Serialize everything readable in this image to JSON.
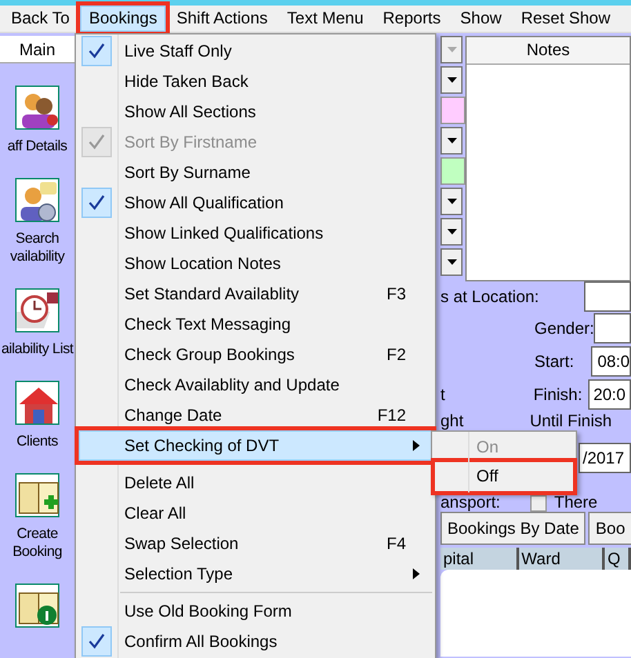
{
  "menubar": [
    {
      "label": "Back To",
      "open": false,
      "annotated": false
    },
    {
      "label": "Bookings",
      "open": true,
      "annotated": true
    },
    {
      "label": "Shift Actions",
      "open": false,
      "annotated": false
    },
    {
      "label": "Text Menu",
      "open": false,
      "annotated": false
    },
    {
      "label": "Reports",
      "open": false,
      "annotated": false
    },
    {
      "label": "Show",
      "open": false,
      "annotated": false
    },
    {
      "label": "Reset Show",
      "open": false,
      "annotated": false
    }
  ],
  "sidebar": {
    "tab": "Main",
    "items": [
      {
        "kind": "staff",
        "lines": [
          "aff Details"
        ]
      },
      {
        "kind": "search",
        "lines": [
          "Search",
          "vailability"
        ]
      },
      {
        "kind": "clock",
        "lines": [
          "ailability List"
        ]
      },
      {
        "kind": "house",
        "lines": [
          "Clients"
        ]
      },
      {
        "kind": "book-plus",
        "lines": [
          "Create",
          "Booking"
        ]
      },
      {
        "kind": "book-info"
      }
    ]
  },
  "combos": [
    {
      "kind": "arrow",
      "disabled": true
    },
    {
      "kind": "arrow",
      "disabled": false
    },
    {
      "kind": "swatch",
      "color": "#ffccff"
    },
    {
      "kind": "arrow",
      "disabled": false
    },
    {
      "kind": "swatch",
      "color": "#c0ffc0"
    },
    {
      "kind": "arrow",
      "disabled": false
    },
    {
      "kind": "arrow",
      "disabled": false
    },
    {
      "kind": "arrow",
      "disabled": false
    }
  ],
  "notes": {
    "header": "Notes"
  },
  "form": {
    "location_label": "s at Location:",
    "gender_label": "Gender:",
    "start_label": "Start:",
    "start_value": "08:0",
    "finish_label": "Finish:",
    "finish_value": "20:0",
    "left_text_1": "t",
    "left_text_2": "ght",
    "until_label": "Until Finish",
    "date_value": "/2017",
    "transport_label": "ansport:",
    "there_label": "There",
    "there_checked": false
  },
  "buttons": [
    "Bookings By Date",
    "Boo"
  ],
  "table": {
    "columns": [
      "pital",
      "Ward",
      "Q"
    ]
  },
  "dropdown": {
    "items": [
      {
        "kind": "item",
        "label": "Live Staff Only",
        "checked": true,
        "disabled": false
      },
      {
        "kind": "item",
        "label": "Hide Taken Back",
        "checked": false,
        "disabled": false
      },
      {
        "kind": "item",
        "label": "Show All Sections",
        "checked": false,
        "disabled": false
      },
      {
        "kind": "item",
        "label": "Sort By Firstname",
        "checked": true,
        "disabled": true
      },
      {
        "kind": "item",
        "label": "Sort By Surname",
        "checked": false,
        "disabled": false
      },
      {
        "kind": "item",
        "label": "Show All Qualification",
        "checked": true,
        "disabled": false
      },
      {
        "kind": "item",
        "label": "Show Linked Qualifications",
        "checked": false,
        "disabled": false
      },
      {
        "kind": "item",
        "label": "Show Location Notes",
        "checked": false,
        "disabled": false
      },
      {
        "kind": "item",
        "label": "Set Standard Availablity",
        "shortcut": "F3",
        "checked": false,
        "disabled": false
      },
      {
        "kind": "item",
        "label": "Check Text Messaging",
        "checked": false,
        "disabled": false
      },
      {
        "kind": "item",
        "label": "Check Group Bookings",
        "shortcut": "F2",
        "checked": false,
        "disabled": false
      },
      {
        "kind": "item",
        "label": "Check Availablity and Update",
        "checked": false,
        "disabled": false
      },
      {
        "kind": "item",
        "label": "Change Date",
        "shortcut": "F12",
        "checked": false,
        "disabled": false
      },
      {
        "kind": "submenu",
        "label": "Set Checking of DVT",
        "checked": false,
        "disabled": false,
        "highlighted": true,
        "annotated": true
      },
      {
        "kind": "separator"
      },
      {
        "kind": "item",
        "label": "Delete All",
        "checked": false,
        "disabled": false
      },
      {
        "kind": "item",
        "label": "Clear All",
        "checked": false,
        "disabled": false
      },
      {
        "kind": "item",
        "label": "Swap Selection",
        "shortcut": "F4",
        "checked": false,
        "disabled": false
      },
      {
        "kind": "submenu",
        "label": "Selection Type",
        "checked": false,
        "disabled": false
      },
      {
        "kind": "separator"
      },
      {
        "kind": "item",
        "label": "Use Old Booking Form",
        "checked": false,
        "disabled": false
      },
      {
        "kind": "item",
        "label": "Confirm All Bookings",
        "checked": true,
        "disabled": false
      }
    ]
  },
  "submenu": {
    "items": [
      {
        "label": "On",
        "disabled": true,
        "annotated": false
      },
      {
        "label": "Off",
        "disabled": false,
        "annotated": true
      }
    ]
  }
}
